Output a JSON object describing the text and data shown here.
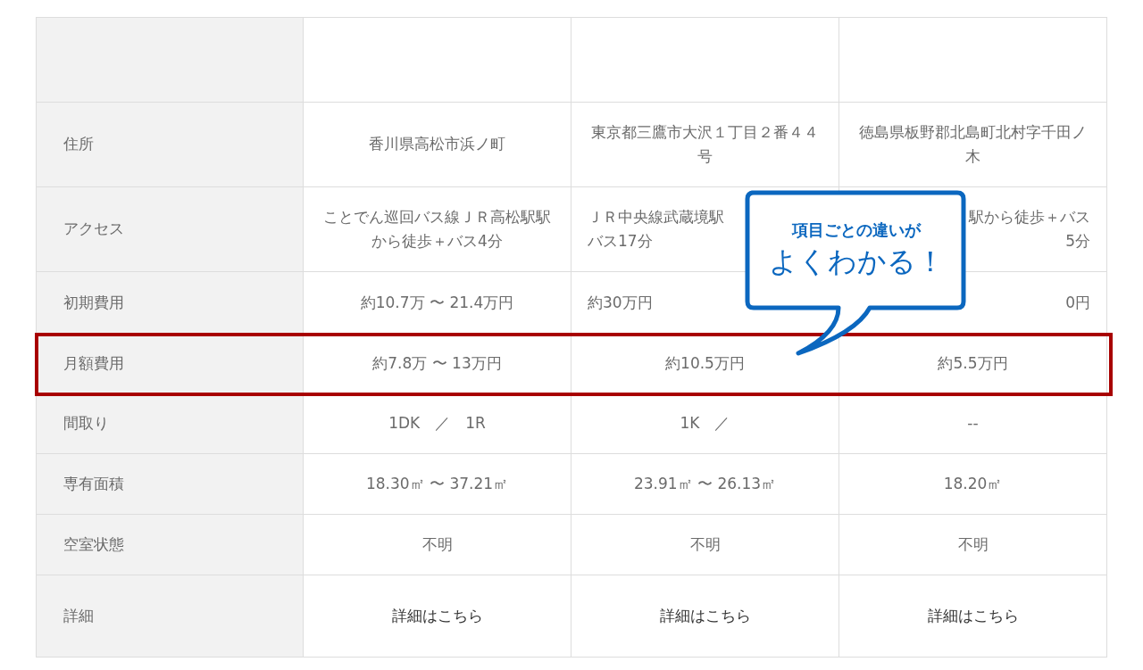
{
  "table": {
    "rows": [
      {
        "label": "住所",
        "highlighted": false,
        "cells": [
          {
            "kind": "text",
            "text": "香川県高松市浜ノ町"
          },
          {
            "kind": "text",
            "text": "東京都三鷹市大沢１丁目２番４４号"
          },
          {
            "kind": "text",
            "text": "徳島県板野郡北島町北村字千田ノ木"
          }
        ]
      },
      {
        "label": "アクセス",
        "highlighted": false,
        "cells": [
          {
            "kind": "text",
            "text": "ことでん巡回バス線ＪＲ高松駅駅から徒歩＋バス4分"
          },
          {
            "kind": "clipped-end",
            "text": "ＪＲ中央線武蔵境駅バス17分"
          },
          {
            "kind": "clipped-start",
            "text": "駅から徒歩＋バス5分"
          }
        ]
      },
      {
        "label": "初期費用",
        "highlighted": false,
        "cells": [
          {
            "kind": "text",
            "text": "約10.7万 〜 21.4万円"
          },
          {
            "kind": "clipped-end",
            "text": "約30万円"
          },
          {
            "kind": "clipped-start",
            "text": "0円"
          }
        ]
      },
      {
        "label": "月額費用",
        "highlighted": true,
        "cells": [
          {
            "kind": "text",
            "text": "約7.8万 〜 13万円"
          },
          {
            "kind": "text",
            "text": "約10.5万円"
          },
          {
            "kind": "text",
            "text": "約5.5万円"
          }
        ]
      },
      {
        "label": "間取り",
        "highlighted": false,
        "cells": [
          {
            "kind": "text",
            "text": "1DK　／　1R"
          },
          {
            "kind": "text",
            "text": "1K　／"
          },
          {
            "kind": "text",
            "text": "--"
          }
        ]
      },
      {
        "label": "専有面積",
        "highlighted": false,
        "cells": [
          {
            "kind": "text",
            "text": "18.30㎡ 〜 37.21㎡"
          },
          {
            "kind": "text",
            "text": "23.91㎡ 〜 26.13㎡"
          },
          {
            "kind": "text",
            "text": "18.20㎡"
          }
        ]
      },
      {
        "label": "空室状態",
        "highlighted": false,
        "cells": [
          {
            "kind": "text",
            "text": "不明"
          },
          {
            "kind": "text",
            "text": "不明"
          },
          {
            "kind": "text",
            "text": "不明"
          }
        ]
      },
      {
        "label": "詳細",
        "highlighted": false,
        "cells": [
          {
            "kind": "link",
            "text": "詳細はこちら"
          },
          {
            "kind": "link",
            "text": "詳細はこちら"
          },
          {
            "kind": "link",
            "text": "詳細はこちら"
          }
        ]
      }
    ]
  },
  "callout": {
    "lines": [
      "項目ごとの違いが",
      "よくわかる！"
    ]
  }
}
